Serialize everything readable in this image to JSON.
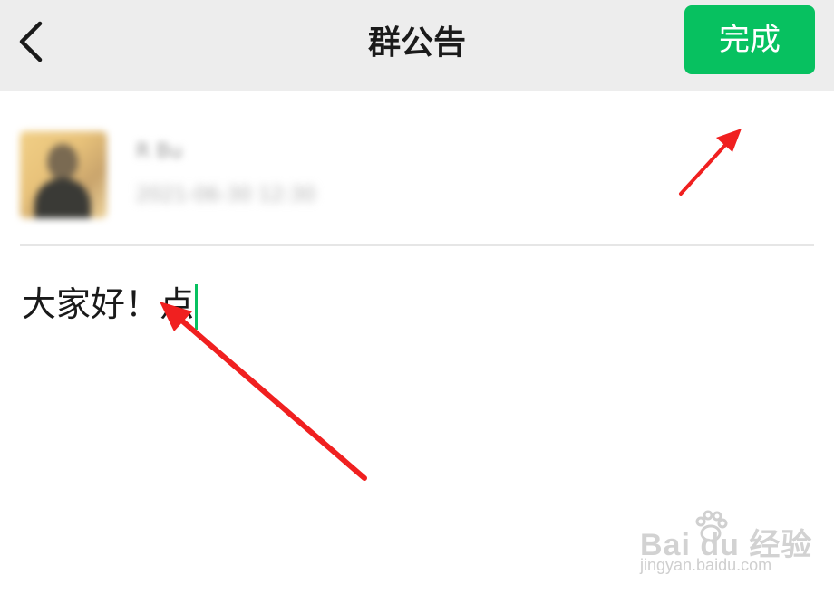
{
  "nav": {
    "back_icon": "chevron-left-icon",
    "title": "群公告",
    "done_label": "完成",
    "background": "#ededed",
    "accent": "#07c160"
  },
  "author": {
    "name": "R Bu",
    "time": "2021-06-30 12:30"
  },
  "editor": {
    "text": "大家好！点"
  },
  "watermark": {
    "brand": "Bai du 经验",
    "url": "jingyan.baidu.com"
  }
}
